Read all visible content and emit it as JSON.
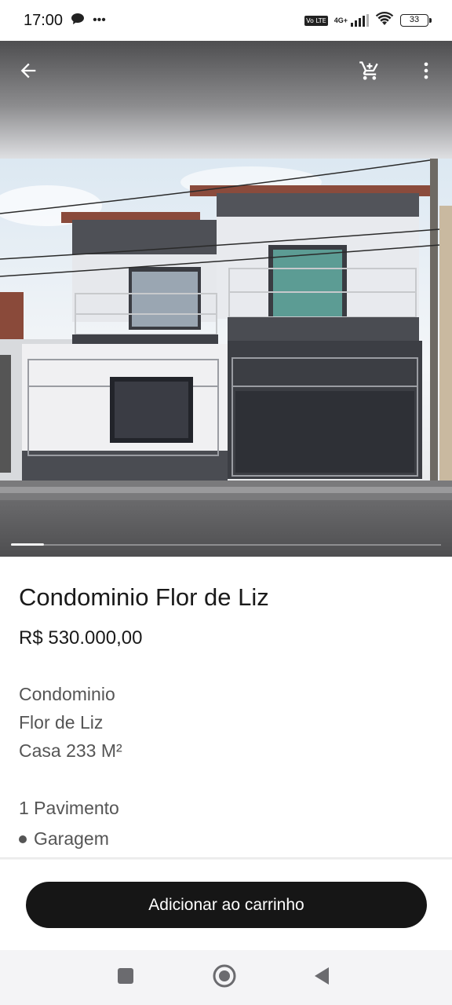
{
  "status_bar": {
    "time": "17:00",
    "more": "•••",
    "network": "4G+",
    "lte": "Vo LTE",
    "battery": "33"
  },
  "toolbar": {
    "back_icon": "arrow-left-icon",
    "cart_icon": "cart-icon",
    "more_icon": "more-vertical-icon"
  },
  "gallery": {
    "image_alt": "house-photo",
    "current_page": 1
  },
  "product": {
    "title": "Condominio Flor de Liz",
    "price": "R$ 530.000,00",
    "description": [
      "Condominio",
      "Flor de Liz",
      "Casa 233 M²",
      "1 Pavimento",
      "Garagem"
    ]
  },
  "actions": {
    "add_to_cart": "Adicionar ao carrinho"
  },
  "nav": {
    "recent_icon": "square-icon",
    "home_icon": "circle-icon",
    "back_icon": "triangle-back-icon"
  }
}
